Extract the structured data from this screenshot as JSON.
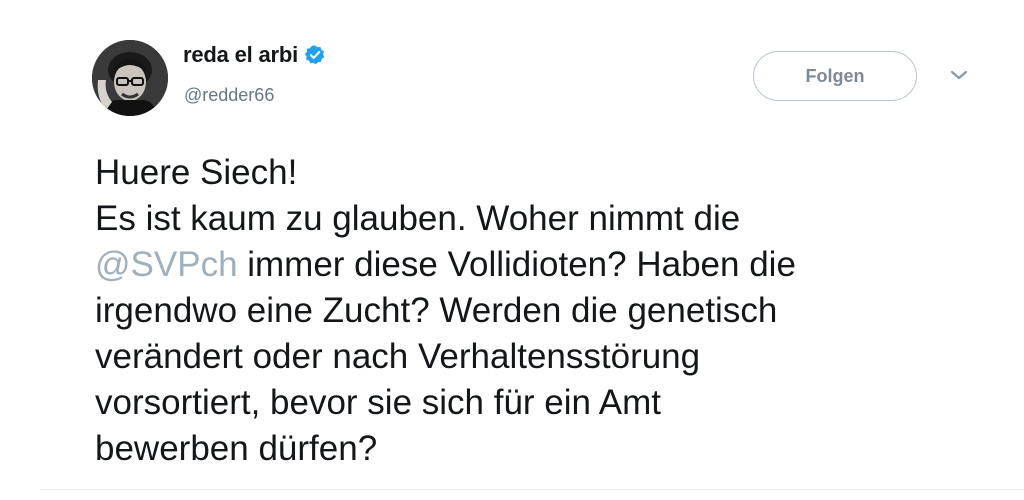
{
  "user": {
    "display_name": "reda el arbi",
    "handle": "@redder66",
    "verified": true,
    "avatar_icon": "profile-photo"
  },
  "actions": {
    "follow_label": "Folgen",
    "menu_icon": "chevron-down-icon"
  },
  "tweet": {
    "line1": "Huere Siech!",
    "line2": "Es ist kaum zu glauben. Woher nimmt die",
    "line3_mention": "@SVPch",
    "line3_rest": " immer diese Vollidioten? Haben die",
    "line4": "irgendwo eine Zucht? Werden die genetisch",
    "line5": "verändert oder nach Verhaltensstörung",
    "line6": "vorsortiert, bevor sie sich für ein Amt",
    "line7": "bewerben dürfen?"
  },
  "colors": {
    "verified_blue": "#1da1f2",
    "mention": "#9fb0bc",
    "text": "#14171a",
    "secondary": "#657786"
  }
}
